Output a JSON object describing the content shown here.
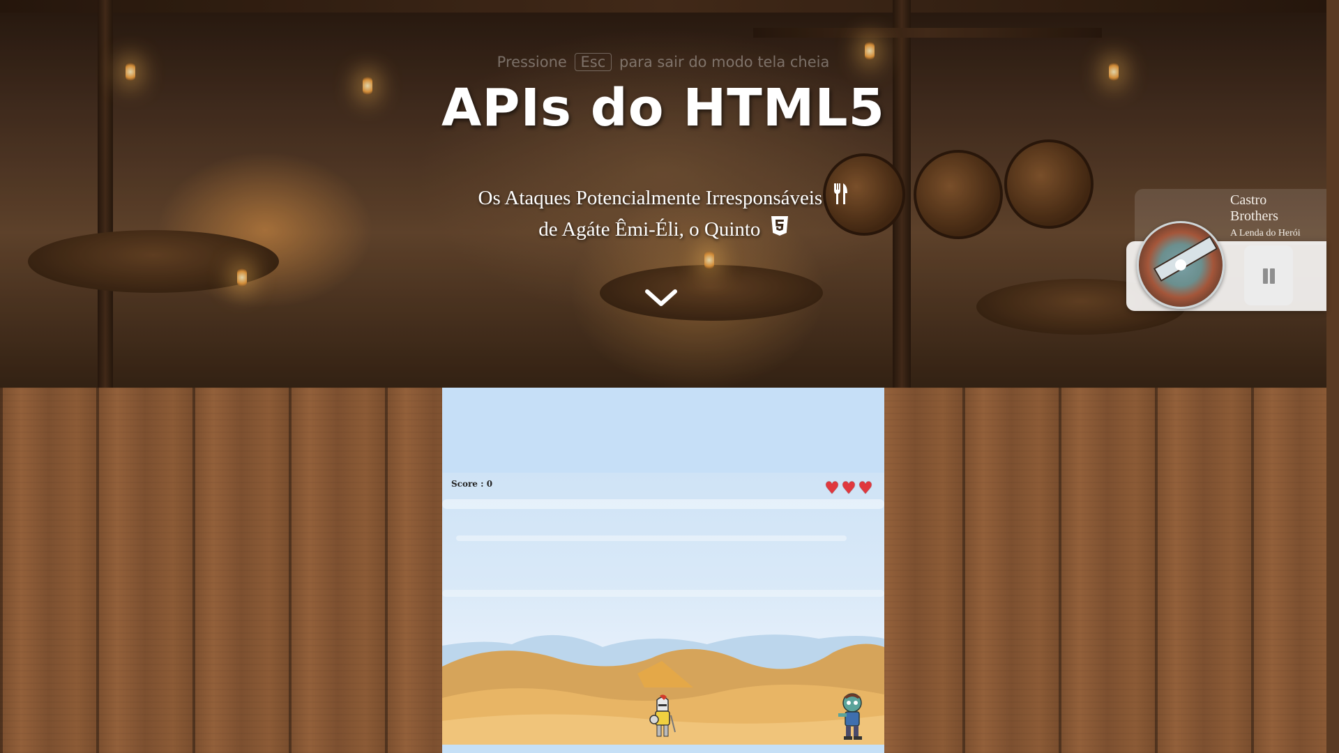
{
  "fullscreen_hint": {
    "before": "Pressione",
    "key": "Esc",
    "after": "para sair do modo tela cheia"
  },
  "hero": {
    "title": "APIs do HTML5",
    "subtitle_line1": "Os Ataques Potencialmente Irresponsáveis",
    "subtitle_line2": "de Agáte Êmi-Éli, o Quinto",
    "icons": [
      "utensils-icon",
      "html5-icon",
      "chevron-down-icon"
    ]
  },
  "player": {
    "track": "Castro Brothers",
    "album": "A Lenda do Herói",
    "state": "playing",
    "pause_icon": "pause-icon"
  },
  "game": {
    "score_label": "Score : 0",
    "lives": 3,
    "heart_color": "#e0383e"
  },
  "colors": {
    "game_sky": "#c6dff7",
    "wood": "#93603a"
  }
}
